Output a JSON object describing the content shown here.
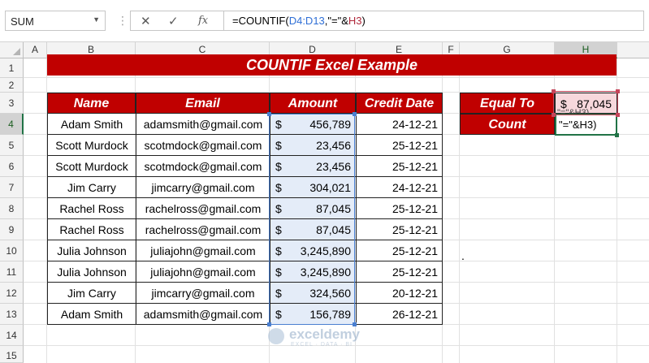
{
  "formula_bar": {
    "name_box": "SUM",
    "formula_prefix": "=COUNTIF(",
    "formula_ref1": "D4:D13",
    "formula_mid": ",\"=\"&",
    "formula_ref2": "H3",
    "formula_suffix": ")"
  },
  "columns": [
    "A",
    "B",
    "C",
    "D",
    "E",
    "F",
    "G",
    "H"
  ],
  "rows": [
    "1",
    "2",
    "3",
    "4",
    "5",
    "6",
    "7",
    "8",
    "9",
    "10",
    "11",
    "12",
    "13",
    "14",
    "15"
  ],
  "title": "COUNTIF Excel Example",
  "table": {
    "headers": {
      "name": "Name",
      "email": "Email",
      "amount": "Amount",
      "date": "Credit Date"
    },
    "currency": "$",
    "rows": [
      {
        "name": "Adam Smith",
        "email": "adamsmith@gmail.com",
        "amount": "456,789",
        "date": "24-12-21"
      },
      {
        "name": "Scott Murdock",
        "email": "scotmdock@gmail.com",
        "amount": "23,456",
        "date": "25-12-21"
      },
      {
        "name": "Scott Murdock",
        "email": "scotmdock@gmail.com",
        "amount": "23,456",
        "date": "25-12-21"
      },
      {
        "name": "Jim Carry",
        "email": "jimcarry@gmail.com",
        "amount": "304,021",
        "date": "24-12-21"
      },
      {
        "name": "Rachel Ross",
        "email": "rachelross@gmail.com",
        "amount": "87,045",
        "date": "25-12-21"
      },
      {
        "name": "Rachel Ross",
        "email": "rachelross@gmail.com",
        "amount": "87,045",
        "date": "25-12-21"
      },
      {
        "name": "Julia Johnson",
        "email": "juliajohn@gmail.com",
        "amount": "3,245,890",
        "date": "25-12-21"
      },
      {
        "name": "Julia Johnson",
        "email": "juliajohn@gmail.com",
        "amount": "3,245,890",
        "date": "25-12-21"
      },
      {
        "name": "Jim Carry",
        "email": "jimcarry@gmail.com",
        "amount": "324,560",
        "date": "20-12-21"
      },
      {
        "name": "Adam Smith",
        "email": "adamsmith@gmail.com",
        "amount": "156,789",
        "date": "26-12-21"
      }
    ]
  },
  "side": {
    "equal_label": "Equal To",
    "equal_currency": "$",
    "equal_value": "87,045",
    "count_label": "Count",
    "count_edit_text": "\"=\"&H3)",
    "count_overflow_text": "\"=\"&H3)"
  },
  "dot_mark": ".",
  "watermark": {
    "text": "exceldemy",
    "sub": "EXCEL · DATA · BI"
  },
  "colors": {
    "header_red": "#c00000",
    "selection_green": "#217346",
    "range_blue": "#4a7fd0",
    "ref_red": "#c6455a"
  }
}
